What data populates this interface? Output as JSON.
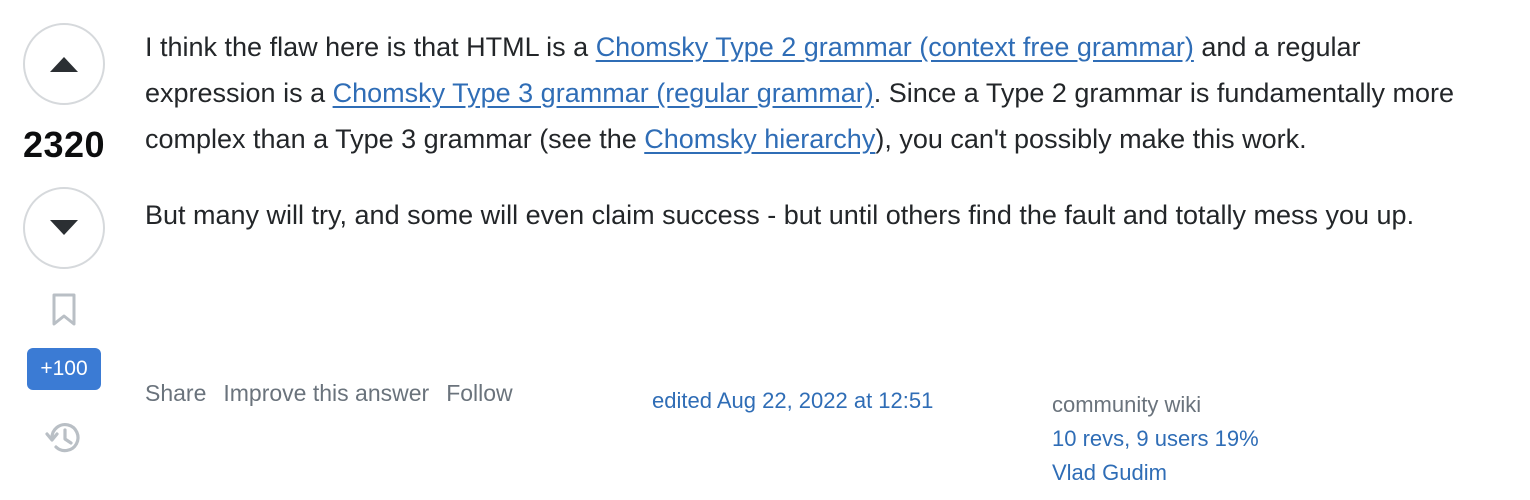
{
  "vote": {
    "count": "2320",
    "bounty": "+100",
    "up_icon": "triangle-up-icon",
    "down_icon": "triangle-down-icon",
    "bookmark_icon": "bookmark-icon",
    "history_icon": "history-icon"
  },
  "answer": {
    "p1": {
      "t1": "I think the flaw here is that HTML is a ",
      "link1": "Chomsky Type 2 grammar (context free grammar)",
      "t2": " and a regular expression is a ",
      "link2": "Chomsky Type 3 grammar (regular grammar)",
      "t3": ". Since a Type 2 grammar is fundamentally more complex than a Type 3 grammar (see the ",
      "link3": "Chomsky hierarchy",
      "t4": "), you can't possibly make this work."
    },
    "p2": "But many will try, and some will even claim success - but until others find the fault and totally mess you up."
  },
  "menu": {
    "share": "Share",
    "improve": "Improve this answer",
    "follow": "Follow"
  },
  "edited": "edited Aug 22, 2022 at 12:51",
  "owner": {
    "community": "community wiki",
    "revs": "10 revs, 9 users 19%",
    "user": "Vlad Gudim"
  },
  "colors": {
    "link": "#2f6db6",
    "muted": "#6a737c",
    "bounty_bg": "#3b7bd4",
    "border": "#d6d9dc"
  }
}
